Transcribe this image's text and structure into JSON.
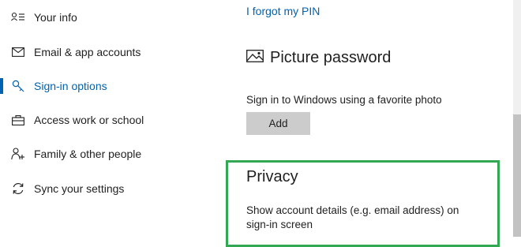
{
  "sidebar": {
    "items": [
      {
        "label": "Your info",
        "icon": "person-info-icon",
        "active": false
      },
      {
        "label": "Email & app accounts",
        "icon": "mail-icon",
        "active": false
      },
      {
        "label": "Sign-in options",
        "icon": "key-icon",
        "active": true
      },
      {
        "label": "Access work or school",
        "icon": "briefcase-icon",
        "active": false
      },
      {
        "label": "Family & other people",
        "icon": "people-icon",
        "active": false
      },
      {
        "label": "Sync your settings",
        "icon": "sync-icon",
        "active": false
      }
    ]
  },
  "pin": {
    "forgot_link": "I forgot my PIN"
  },
  "picture_password": {
    "title": "Picture password",
    "icon": "picture-icon",
    "description": "Sign in to Windows using a favorite photo",
    "add_label": "Add"
  },
  "privacy": {
    "title": "Privacy",
    "description": "Show account details (e.g. email address) on sign-in screen"
  },
  "colors": {
    "accent": "#0063b1",
    "highlight_border": "#33a852",
    "button_bg": "#cccccc"
  }
}
